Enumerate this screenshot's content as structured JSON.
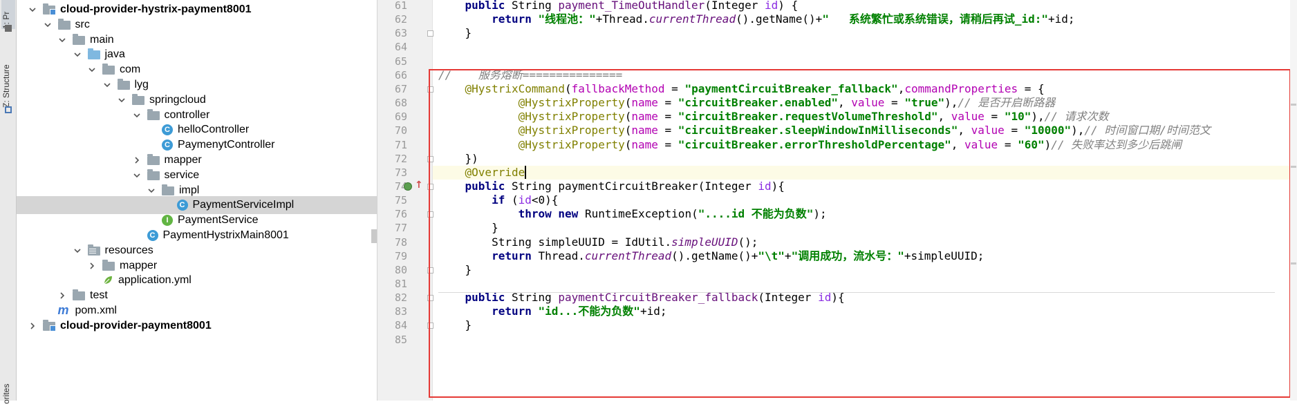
{
  "toolstrip": {
    "project_tab": "1: Pr",
    "structure_tab": "Z: Structure",
    "favorites_tab": "orites"
  },
  "tree": {
    "items": [
      {
        "label": "cloud-provider-hystrix-payment8001",
        "icon": "module-folder-icon",
        "arrow": "down",
        "depth": 1,
        "bold": true
      },
      {
        "label": "src",
        "icon": "folder-icon",
        "arrow": "down",
        "depth": 2
      },
      {
        "label": "main",
        "icon": "folder-icon",
        "arrow": "down",
        "depth": 3
      },
      {
        "label": "java",
        "icon": "source-folder-icon",
        "arrow": "down",
        "depth": 4
      },
      {
        "label": "com",
        "icon": "package-icon",
        "arrow": "down",
        "depth": 5
      },
      {
        "label": "lyg",
        "icon": "package-icon",
        "arrow": "down",
        "depth": 6
      },
      {
        "label": "springcloud",
        "icon": "package-icon",
        "arrow": "down",
        "depth": 7
      },
      {
        "label": "controller",
        "icon": "package-icon",
        "arrow": "down",
        "depth": 8
      },
      {
        "label": "helloController",
        "icon": "class-icon",
        "arrow": "none",
        "depth": 9
      },
      {
        "label": "PaymenytController",
        "icon": "class-icon",
        "arrow": "none",
        "depth": 9
      },
      {
        "label": "mapper",
        "icon": "package-icon",
        "arrow": "right",
        "depth": 8
      },
      {
        "label": "service",
        "icon": "package-icon",
        "arrow": "down",
        "depth": 8
      },
      {
        "label": "impl",
        "icon": "package-icon",
        "arrow": "down",
        "depth": 9
      },
      {
        "label": "PaymentServiceImpl",
        "icon": "class-icon",
        "arrow": "none",
        "depth": 10,
        "selected": true
      },
      {
        "label": "PaymentService",
        "icon": "interface-icon",
        "arrow": "none",
        "depth": 9
      },
      {
        "label": "PaymentHystrixMain8001",
        "icon": "main-class-icon",
        "arrow": "none",
        "depth": 8
      },
      {
        "label": "resources",
        "icon": "resources-folder-icon",
        "arrow": "down",
        "depth": 4
      },
      {
        "label": "mapper",
        "icon": "folder-icon",
        "arrow": "right",
        "depth": 5
      },
      {
        "label": "application.yml",
        "icon": "yml-file-icon",
        "arrow": "none",
        "depth": 5
      },
      {
        "label": "test",
        "icon": "folder-icon",
        "arrow": "right",
        "depth": 3
      },
      {
        "label": "pom.xml",
        "icon": "maven-pom-icon",
        "arrow": "none",
        "depth": 2
      },
      {
        "label": "cloud-provider-payment8001",
        "icon": "module-folder-icon",
        "arrow": "right",
        "depth": 1,
        "bold": true
      }
    ]
  },
  "editor": {
    "line_numbers": [
      "61",
      "62",
      "63",
      "64",
      "65",
      "66",
      "67",
      "68",
      "69",
      "70",
      "71",
      "72",
      "73",
      "74",
      "75",
      "76",
      "77",
      "78",
      "79",
      "80",
      "81",
      "82",
      "83",
      "84",
      "85"
    ],
    "lines": [
      [
        {
          "t": "    "
        },
        {
          "t": "public",
          "c": "k"
        },
        {
          "t": " String "
        },
        {
          "t": "payment_TimeOutHandler",
          "c": "n"
        },
        {
          "t": "("
        },
        {
          "t": "Integer",
          "c": "p"
        },
        {
          "t": " "
        },
        {
          "t": "id",
          "c": "pu"
        },
        {
          "t": ") {"
        }
      ],
      [
        {
          "t": "        "
        },
        {
          "t": "return",
          "c": "k"
        },
        {
          "t": " "
        },
        {
          "t": "\"线程池：\"",
          "c": "s"
        },
        {
          "t": "+Thread."
        },
        {
          "t": "currentThread",
          "c": "it"
        },
        {
          "t": "().getName()+"
        },
        {
          "t": "\"   系统繁忙或系统错误，请稍后再试_id:\"",
          "c": "s"
        },
        {
          "t": "+id;"
        }
      ],
      [
        {
          "t": "    }"
        }
      ],
      [
        {
          "t": ""
        }
      ],
      [
        {
          "t": ""
        }
      ],
      [
        {
          "t": "//    服务熔断===============",
          "c": "c"
        }
      ],
      [
        {
          "t": "    "
        },
        {
          "t": "@HystrixCommand",
          "c": "a"
        },
        {
          "t": "("
        },
        {
          "t": "fallbackMethod",
          "c": "m"
        },
        {
          "t": " = "
        },
        {
          "t": "\"paymentCircuitBreaker_fallback\"",
          "c": "s"
        },
        {
          "t": ","
        },
        {
          "t": "commandProperties",
          "c": "m"
        },
        {
          "t": " = {"
        }
      ],
      [
        {
          "t": "            "
        },
        {
          "t": "@HystrixProperty",
          "c": "a"
        },
        {
          "t": "("
        },
        {
          "t": "name",
          "c": "m"
        },
        {
          "t": " = "
        },
        {
          "t": "\"circuitBreaker.enabled\"",
          "c": "s"
        },
        {
          "t": ", "
        },
        {
          "t": "value",
          "c": "m"
        },
        {
          "t": " = "
        },
        {
          "t": "\"true\"",
          "c": "s"
        },
        {
          "t": "),"
        },
        {
          "t": "// 是否开启断路器",
          "c": "c"
        }
      ],
      [
        {
          "t": "            "
        },
        {
          "t": "@HystrixProperty",
          "c": "a"
        },
        {
          "t": "("
        },
        {
          "t": "name",
          "c": "m"
        },
        {
          "t": " = "
        },
        {
          "t": "\"circuitBreaker.requestVolumeThreshold\"",
          "c": "s"
        },
        {
          "t": ", "
        },
        {
          "t": "value",
          "c": "m"
        },
        {
          "t": " = "
        },
        {
          "t": "\"10\"",
          "c": "s"
        },
        {
          "t": "),"
        },
        {
          "t": "// 请求次数",
          "c": "c"
        }
      ],
      [
        {
          "t": "            "
        },
        {
          "t": "@HystrixProperty",
          "c": "a"
        },
        {
          "t": "("
        },
        {
          "t": "name",
          "c": "m"
        },
        {
          "t": " = "
        },
        {
          "t": "\"circuitBreaker.sleepWindowInMilliseconds\"",
          "c": "s"
        },
        {
          "t": ", "
        },
        {
          "t": "value",
          "c": "m"
        },
        {
          "t": " = "
        },
        {
          "t": "\"10000\"",
          "c": "s"
        },
        {
          "t": "),"
        },
        {
          "t": "// 时间窗口期/时间范文",
          "c": "c"
        }
      ],
      [
        {
          "t": "            "
        },
        {
          "t": "@HystrixProperty",
          "c": "a"
        },
        {
          "t": "("
        },
        {
          "t": "name",
          "c": "m"
        },
        {
          "t": " = "
        },
        {
          "t": "\"circuitBreaker.errorThresholdPercentage\"",
          "c": "s"
        },
        {
          "t": ", "
        },
        {
          "t": "value",
          "c": "m"
        },
        {
          "t": " = "
        },
        {
          "t": "\"60\"",
          "c": "s"
        },
        {
          "t": ")"
        },
        {
          "t": "// 失败率达到多少后跳闸",
          "c": "c"
        }
      ],
      [
        {
          "t": "    })"
        }
      ],
      [
        {
          "t": "    "
        },
        {
          "t": "@Override",
          "c": "a"
        }
      ],
      [
        {
          "t": "    "
        },
        {
          "t": "public",
          "c": "k"
        },
        {
          "t": " String "
        },
        {
          "t": "paymentCircuitBreaker",
          "c": "p"
        },
        {
          "t": "(Integer "
        },
        {
          "t": "id",
          "c": "pu"
        },
        {
          "t": "){"
        }
      ],
      [
        {
          "t": "        "
        },
        {
          "t": "if",
          "c": "k"
        },
        {
          "t": " ("
        },
        {
          "t": "id",
          "c": "pu"
        },
        {
          "t": "<0){"
        }
      ],
      [
        {
          "t": "            "
        },
        {
          "t": "throw",
          "c": "k"
        },
        {
          "t": " "
        },
        {
          "t": "new",
          "c": "k"
        },
        {
          "t": " RuntimeException("
        },
        {
          "t": "\"....id 不能为负数\"",
          "c": "s"
        },
        {
          "t": ");"
        }
      ],
      [
        {
          "t": "        }"
        }
      ],
      [
        {
          "t": "        String simpleUUID = IdUtil."
        },
        {
          "t": "simpleUUID",
          "c": "it"
        },
        {
          "t": "();"
        }
      ],
      [
        {
          "t": "        "
        },
        {
          "t": "return",
          "c": "k"
        },
        {
          "t": " Thread."
        },
        {
          "t": "currentThread",
          "c": "it"
        },
        {
          "t": "().getName()+"
        },
        {
          "t": "\"\\t\"",
          "c": "s"
        },
        {
          "t": "+"
        },
        {
          "t": "\"调用成功，流水号：\"",
          "c": "s"
        },
        {
          "t": "+simpleUUID;"
        }
      ],
      [
        {
          "t": "    }"
        }
      ],
      [
        {
          "t": ""
        }
      ],
      [
        {
          "t": "    "
        },
        {
          "t": "public",
          "c": "k"
        },
        {
          "t": " String "
        },
        {
          "t": "paymentCircuitBreaker_fallback",
          "c": "n"
        },
        {
          "t": "(Integer "
        },
        {
          "t": "id",
          "c": "pu"
        },
        {
          "t": "){"
        }
      ],
      [
        {
          "t": "        "
        },
        {
          "t": "return",
          "c": "k"
        },
        {
          "t": " "
        },
        {
          "t": "\"id...不能为负数\"",
          "c": "s"
        },
        {
          "t": "+id;"
        }
      ],
      [
        {
          "t": "    }"
        }
      ],
      [
        {
          "t": ""
        }
      ]
    ],
    "current_line_index": 12,
    "colors": {
      "keyword": "#000080",
      "string": "#008000",
      "comment": "#808080",
      "annotation": "#808000",
      "highlight_box": "#e53935"
    }
  }
}
